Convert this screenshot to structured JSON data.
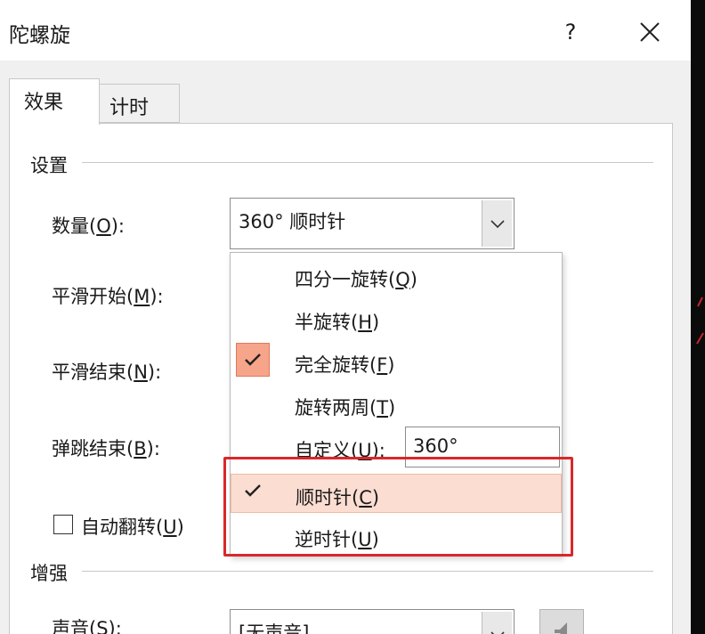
{
  "dialog": {
    "title": "陀螺旋",
    "help_label": "?"
  },
  "tabs": [
    {
      "label": "效果",
      "active": true
    },
    {
      "label": "计时",
      "active": false
    }
  ],
  "settings": {
    "group_label": "设置",
    "amount": {
      "label_pre": "数量(",
      "label_key": "O",
      "label_post": "):",
      "value": "360° 顺时针"
    },
    "smooth_start": {
      "label_pre": "平滑开始(",
      "label_key": "M",
      "label_post": "):"
    },
    "smooth_end": {
      "label_pre": "平滑结束(",
      "label_key": "N",
      "label_post": "):"
    },
    "bounce_end": {
      "label_pre": "弹跳结束(",
      "label_key": "B",
      "label_post": "):"
    },
    "auto_reverse": {
      "label_pre": "自动翻转(",
      "label_key": "U",
      "label_post": ")",
      "checked": false
    }
  },
  "enhance": {
    "group_label": "增强",
    "sound": {
      "label_pre": "声音(",
      "label_key": "S",
      "label_post": "):",
      "value": "[无声音]"
    }
  },
  "menu": {
    "items": [
      {
        "pre": "四分一旋转(",
        "key": "Q",
        "post": ")",
        "checked": false
      },
      {
        "pre": "半旋转(",
        "key": "H",
        "post": ")",
        "checked": false
      },
      {
        "pre": "完全旋转(",
        "key": "F",
        "post": ")",
        "checked": true
      },
      {
        "pre": "旋转两周(",
        "key": "T",
        "post": ")",
        "checked": false
      },
      {
        "pre": "自定义(",
        "key": "U",
        "post": "):",
        "checked": false,
        "input_value": "360°"
      },
      {
        "pre": "顺时针(",
        "key": "C",
        "post": ")",
        "checked": true
      },
      {
        "pre": "逆时针(",
        "key": "U",
        "post": ")",
        "checked": false
      }
    ]
  },
  "colors": {
    "highlight_border": "#d9272a",
    "check_fill": "#f6a48a",
    "hover_fill": "#fbddd2"
  }
}
